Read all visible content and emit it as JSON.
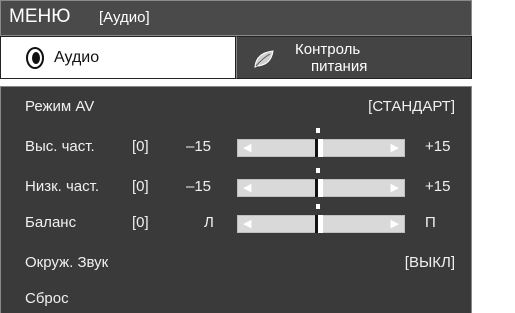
{
  "header": {
    "title": "МЕНЮ",
    "section": "[Аудио]"
  },
  "tabs": [
    {
      "label": "Аудио",
      "icon": "speaker-icon",
      "selected": true
    },
    {
      "label_line1": "Контроль",
      "label_line2": "питания",
      "icon": "leaf-icon",
      "selected": false
    }
  ],
  "settings": {
    "av_mode": {
      "label": "Режим AV",
      "value": "[СТАНДАРТ]"
    },
    "treble": {
      "label": "Выс. част.",
      "value": "[0]",
      "min": "–15",
      "max": "+15",
      "level": 0.5
    },
    "bass": {
      "label": "Низк. част.",
      "value": "[0]",
      "min": "–15",
      "max": "+15",
      "level": 0.5
    },
    "balance": {
      "label": "Баланс",
      "value": "[0]",
      "min": "Л",
      "max": "П",
      "level": 0.5
    },
    "surround": {
      "label": "Окруж. Звук",
      "value": "[ВЫКЛ]"
    },
    "reset": {
      "label": "Сброс"
    }
  },
  "colors": {
    "panel": "#3a3a3a",
    "title_bar": "#4a4a4a",
    "slider_track": "#d9d9d9"
  }
}
